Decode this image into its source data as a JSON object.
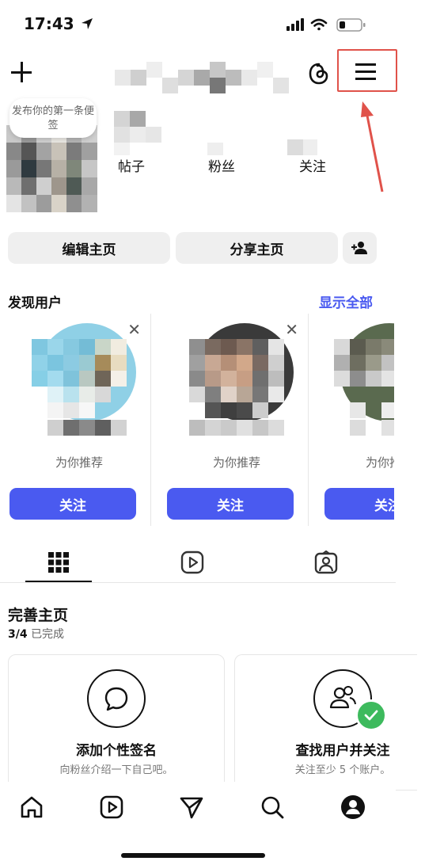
{
  "status_bar": {
    "time": "17:43"
  },
  "profile": {
    "note_text": "发布你的第一条便签",
    "stats": [
      {
        "label": "帖子"
      },
      {
        "label": "粉丝"
      },
      {
        "label": "关注"
      }
    ],
    "edit_profile_label": "编辑主页",
    "share_profile_label": "分享主页"
  },
  "discover": {
    "title": "发现用户",
    "show_all_label": "显示全部",
    "cards": [
      {
        "reason": "为你推荐",
        "follow_label": "关注"
      },
      {
        "reason": "为你推荐",
        "follow_label": "关注"
      },
      {
        "reason": "为你推荐",
        "follow_label": "关注"
      }
    ]
  },
  "complete_profile": {
    "title": "完善主页",
    "progress": "3/4",
    "progress_suffix": "已完成",
    "cards": [
      {
        "title": "添加个性签名",
        "description": "向粉丝介绍一下自己吧。"
      },
      {
        "title": "查找用户并关注",
        "description": "关注至少 5 个账户。"
      }
    ]
  },
  "colors": {
    "accent": "#4a5af0",
    "highlight": "#e0524a"
  }
}
